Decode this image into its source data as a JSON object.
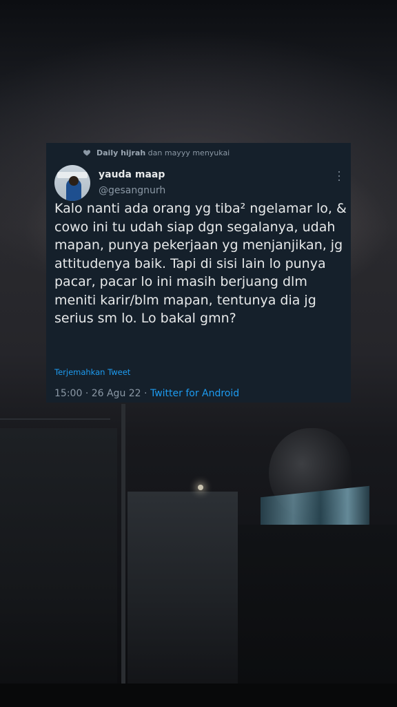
{
  "liked_by": {
    "first_user": "Daily hijrah",
    "rest": "dan mayyy menyukai"
  },
  "tweet": {
    "display_name": "yauda maap",
    "handle": "@gesangnurh",
    "text": "Kalo nanti ada orang yg tiba² ngelamar lo, & cowo ini tu udah siap dgn segalanya, udah mapan, punya pekerjaan yg menjanjikan, jg attitudenya baik. Tapi di sisi lain lo punya pacar, pacar lo ini masih berjuang dlm meniti karir/blm mapan, tentunya dia jg serius sm lo. Lo bakal gmn?",
    "translate_label": "Terjemahkan Tweet",
    "time": "15:00",
    "date": "26 Agu 22",
    "source": "Twitter for Android",
    "separator": "·"
  },
  "colors": {
    "card_bg": "#15202b",
    "text_primary": "#e7e9ea",
    "text_secondary": "#8b98a5",
    "accent": "#1d9bf0"
  },
  "icons": {
    "liked": "heart-icon",
    "menu": "more-vertical-icon",
    "avatar": "avatar"
  }
}
